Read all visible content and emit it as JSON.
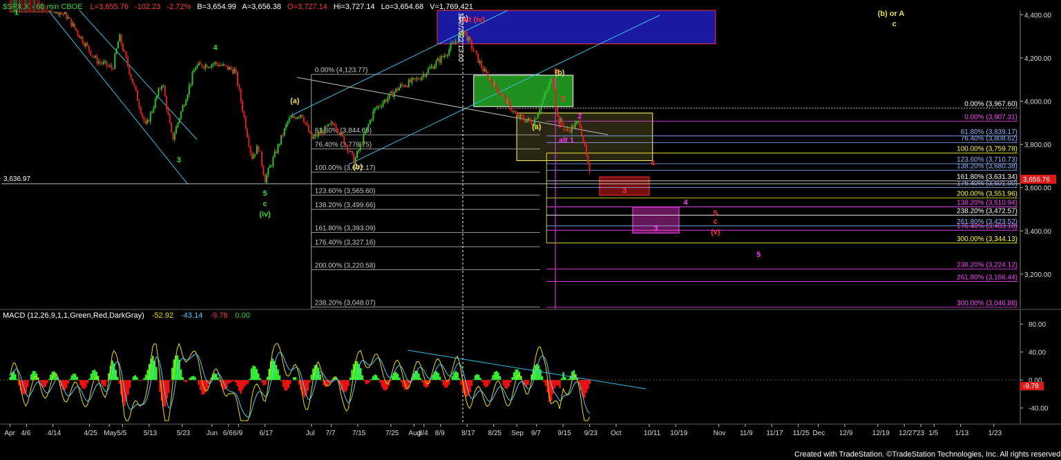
{
  "header": {
    "symbol": "$SPX.X - 60 min CBOE",
    "low": "L=3,655.76",
    "change": "-102.23",
    "change_pct": "-2.72%",
    "bid": "B=3,654.99",
    "ask": "A=3,656.38",
    "open": "O=3,727.14",
    "high": "Hi=3,727.14",
    "lo": "Lo=3,654.68",
    "volume": "V=1,769,421"
  },
  "colors": {
    "background": "#000000",
    "header_symbol": "#3bd43b",
    "header_red": "#ff3b3b",
    "header_white": "#ffffff",
    "up_candle": "#2fc02f",
    "down_candle": "#e02020",
    "macd_pos": "#33ee33",
    "macd_neg": "#ee1111",
    "macd_line": "#f0e000",
    "signal_line": "#4fd0ff",
    "trend": "#37bfe6",
    "wave_green": "#33dd33",
    "wave_yellow": "#e8e04a",
    "wave_red": "#ff3030",
    "wave_magenta": "#ff33ff",
    "fib_gray": "#c8c8c8",
    "fib_white": "#ffffff",
    "fib_yellow": "#ffff33",
    "fib_blue": "#8fb4ff",
    "fib_magenta": "#ff44ff"
  },
  "chart_data": [
    {
      "type": "candlestick",
      "title": "$SPX.X - 60 min CBOE",
      "ylim": [
        3040,
        4420
      ],
      "y_ticks": [
        "4,400.00",
        "4,200.00",
        "4,000.00",
        "3,800.00",
        "3,600.00",
        "3,400.00",
        "3,200.00"
      ],
      "y_tick_values": [
        4400,
        4200,
        4000,
        3800,
        3600,
        3400,
        3200
      ],
      "x_ticks": [
        "Apr",
        "4/6",
        "4/14",
        "4/25",
        "May",
        "5/5",
        "5/13",
        "5/23",
        "Jun",
        "6/6",
        "6/9",
        "6/17",
        "Jul",
        "7/7",
        "7/15",
        "7/25",
        "Aug",
        "8/4",
        "8/9",
        "8/17",
        "8/25",
        "Sep",
        "9/7",
        "9/15",
        "9/23",
        "Oct",
        "10/11",
        "10/19",
        "Nov",
        "11/9",
        "11/17",
        "11/25",
        "Dec",
        "12/9",
        "12/19",
        "12/27",
        "'23",
        "1/5",
        "1/13",
        "1/23"
      ],
      "x_tick_dates": [
        "2022-04-01",
        "2022-04-06",
        "2022-04-14",
        "2022-04-25",
        "2022-05-01",
        "2022-05-05",
        "2022-05-13",
        "2022-05-23",
        "2022-06-01",
        "2022-06-06",
        "2022-06-09",
        "2022-06-17",
        "2022-07-01",
        "2022-07-07",
        "2022-07-15",
        "2022-07-25",
        "2022-08-01",
        "2022-08-04",
        "2022-08-09",
        "2022-08-17",
        "2022-08-25",
        "2022-09-01",
        "2022-09-07",
        "2022-09-15",
        "2022-09-23",
        "2022-10-01",
        "2022-10-11",
        "2022-10-19",
        "2022-11-01",
        "2022-11-09",
        "2022-11-17",
        "2022-11-25",
        "2022-12-01",
        "2022-12-09",
        "2022-12-19",
        "2022-12-27",
        "2023-01-01",
        "2023-01-05",
        "2023-01-13",
        "2023-01-23"
      ],
      "price_path": [
        {
          "date": "2022-04-01",
          "price": 4540
        },
        {
          "date": "2022-04-04",
          "price": 4580
        },
        {
          "date": "2022-04-08",
          "price": 4485
        },
        {
          "date": "2022-04-18",
          "price": 4395
        },
        {
          "date": "2022-04-27",
          "price": 4190
        },
        {
          "date": "2022-05-02",
          "price": 4150
        },
        {
          "date": "2022-05-04",
          "price": 4300
        },
        {
          "date": "2022-05-12",
          "price": 3880
        },
        {
          "date": "2022-05-17",
          "price": 4090
        },
        {
          "date": "2022-05-20",
          "price": 3820
        },
        {
          "date": "2022-05-27",
          "price": 4160
        },
        {
          "date": "2022-06-02",
          "price": 4175
        },
        {
          "date": "2022-06-08",
          "price": 4140
        },
        {
          "date": "2022-06-13",
          "price": 3740
        },
        {
          "date": "2022-06-15",
          "price": 3790
        },
        {
          "date": "2022-06-17",
          "price": 3637
        },
        {
          "date": "2022-06-24",
          "price": 3910
        },
        {
          "date": "2022-06-28",
          "price": 3945
        },
        {
          "date": "2022-07-01",
          "price": 3825
        },
        {
          "date": "2022-07-08",
          "price": 3900
        },
        {
          "date": "2022-07-14",
          "price": 3723
        },
        {
          "date": "2022-07-20",
          "price": 3960
        },
        {
          "date": "2022-07-28",
          "price": 4070
        },
        {
          "date": "2022-08-02",
          "price": 4100
        },
        {
          "date": "2022-08-10",
          "price": 4210
        },
        {
          "date": "2022-08-16",
          "price": 4325
        },
        {
          "date": "2022-08-22",
          "price": 4140
        },
        {
          "date": "2022-08-26",
          "price": 4060
        },
        {
          "date": "2022-09-01",
          "price": 3930
        },
        {
          "date": "2022-09-06",
          "price": 3900
        },
        {
          "date": "2022-09-12",
          "price": 4120
        },
        {
          "date": "2022-09-13",
          "price": 3935
        },
        {
          "date": "2022-09-16",
          "price": 3860
        },
        {
          "date": "2022-09-20",
          "price": 3905
        },
        {
          "date": "2022-09-23",
          "price": 3660
        }
      ],
      "last_price_label": "3,656.76",
      "left_level_label": "3,636.97",
      "time_label": "11/2/2022 13:00",
      "zones": [
        {
          "name": "blue",
          "price_top": 4430,
          "price_bottom": 4265
        },
        {
          "name": "green",
          "price_top": 4120,
          "price_bottom": 3975
        },
        {
          "name": "yellow",
          "price_top": 3945,
          "price_bottom": 3725
        },
        {
          "name": "red",
          "label": "3",
          "price_top": 3650,
          "price_bottom": 3565
        },
        {
          "name": "magenta",
          "label": "3",
          "price_top": 3510,
          "price_bottom": 3390
        }
      ],
      "fib_levels": [
        {
          "label": "0.00% (4,123.77)",
          "price": 4123.77,
          "group": "gray"
        },
        {
          "label": "61.80% (3,844.65)",
          "price": 3844.65,
          "group": "gray"
        },
        {
          "label": "76.40% (3,778.75)",
          "price": 3778.75,
          "group": "gray"
        },
        {
          "label": "100.00% (3,672.17)",
          "price": 3672.17,
          "group": "gray"
        },
        {
          "label": "123.60% (3,565.60)",
          "price": 3565.6,
          "group": "gray"
        },
        {
          "label": "138.20% (3,499.66)",
          "price": 3499.66,
          "group": "gray"
        },
        {
          "label": "161.80% (3,393.09)",
          "price": 3393.09,
          "group": "gray"
        },
        {
          "label": "176.40% (3,327.16)",
          "price": 3327.16,
          "group": "gray"
        },
        {
          "label": "200.00% (3,220.58)",
          "price": 3220.58,
          "group": "gray"
        },
        {
          "label": "238.20% (3,048.07)",
          "price": 3048.07,
          "group": "gray"
        },
        {
          "label": "0.00% (3,967.60)",
          "price": 3967.6,
          "group": "white"
        },
        {
          "label": "0.00% (3,907.31)",
          "price": 3907.31,
          "group": "magenta"
        },
        {
          "label": "61.80% (3,839.17)",
          "price": 3839.17,
          "group": "blue"
        },
        {
          "label": "76.40% (3,808.62)",
          "price": 3808.62,
          "group": "blue"
        },
        {
          "label": "100.00% (3,759.78)",
          "price": 3759.78,
          "group": "yellow"
        },
        {
          "label": "123.60% (3,710.73)",
          "price": 3710.73,
          "group": "blue"
        },
        {
          "label": "138.20% (3,680.38)",
          "price": 3680.38,
          "group": "blue"
        },
        {
          "label": "161.80% (3,631.34)",
          "price": 3631.34,
          "group": "white"
        },
        {
          "label": "176.40% (3,601.00)",
          "price": 3601.0,
          "group": "blue"
        },
        {
          "label": "200.00% (3,551.96)",
          "price": 3551.96,
          "group": "yellow"
        },
        {
          "label": "138.20% (3,510.94)",
          "price": 3510.94,
          "group": "magenta"
        },
        {
          "label": "238.20% (3,472.57)",
          "price": 3472.57,
          "group": "white"
        },
        {
          "label": "261.80% (3,423.52)",
          "price": 3423.52,
          "group": "blue"
        },
        {
          "label": "176.40% (3,403.18)",
          "price": 3403.18,
          "group": "magenta"
        },
        {
          "label": "300.00% (3,344.13)",
          "price": 3344.13,
          "group": "yellow"
        },
        {
          "label": "238.20% (3,224.12)",
          "price": 3224.12,
          "group": "magenta"
        },
        {
          "label": "261.80% (3,166.44)",
          "price": 3166.44,
          "group": "magenta"
        },
        {
          "label": "300.00% (3,046.88)",
          "price": 3046.88,
          "group": "magenta"
        }
      ],
      "wave_labels": [
        {
          "text": "1",
          "date": "2022-04-03",
          "price": 4400,
          "color": "green"
        },
        {
          "text": "3",
          "date": "2022-05-22",
          "price": 3718,
          "color": "green"
        },
        {
          "text": "4",
          "date": "2022-06-02",
          "price": 4237,
          "color": "green"
        },
        {
          "text": "5",
          "date": "2022-06-17",
          "price": 3562,
          "color": "green"
        },
        {
          "text": "c",
          "date": "2022-06-17",
          "price": 3515,
          "color": "green"
        },
        {
          "text": "(iv)",
          "date": "2022-06-17",
          "price": 3466,
          "color": "green"
        },
        {
          "text": "(a)",
          "date": "2022-06-26",
          "price": 3990,
          "color": "yellow"
        },
        {
          "text": "(b)",
          "date": "2022-07-15",
          "price": 3685,
          "color": "yellow"
        },
        {
          "text": "(c)",
          "date": "2022-08-16",
          "price": 4372,
          "color": "white"
        },
        {
          "text": "alt (iv)",
          "date": "2022-08-19",
          "price": 4365,
          "color": "red"
        },
        {
          "text": "(a)",
          "date": "2022-09-07",
          "price": 3870,
          "color": "yellow"
        },
        {
          "text": "b",
          "date": "2022-09-13",
          "price": 4128,
          "color": "red"
        },
        {
          "text": "(b)",
          "date": "2022-09-14",
          "price": 4122,
          "color": "yellow"
        },
        {
          "text": "2",
          "date": "2022-09-15",
          "price": 4000,
          "color": "red"
        },
        {
          "text": "1",
          "date": "2022-09-14",
          "price": 3880,
          "color": "red"
        },
        {
          "text": "2",
          "date": "2022-09-20",
          "price": 3920,
          "color": "magenta"
        },
        {
          "text": "alt 1",
          "date": "2022-09-16",
          "price": 3808,
          "color": "magenta"
        },
        {
          "text": "4",
          "date": "2022-10-12",
          "price": 3703,
          "color": "red"
        },
        {
          "text": "4",
          "date": "2022-10-22",
          "price": 3520,
          "color": "magenta"
        },
        {
          "text": "5",
          "date": "2022-10-31",
          "price": 3472,
          "color": "red"
        },
        {
          "text": "c",
          "date": "2022-10-31",
          "price": 3433,
          "color": "red"
        },
        {
          "text": "(v)",
          "date": "2022-10-31",
          "price": 3384,
          "color": "red"
        },
        {
          "text": "5",
          "date": "2022-11-13",
          "price": 3280,
          "color": "magenta"
        },
        {
          "text": "(b) or A",
          "date": "2022-12-23",
          "price": 4395,
          "color": "yellow"
        },
        {
          "text": "c",
          "date": "2022-12-24",
          "price": 4346,
          "color": "yellow"
        }
      ]
    },
    {
      "type": "line",
      "title": "MACD (12,26,9,1,1,Green,Red,DarkGray)",
      "values_printed": [
        "-52.92",
        "-43.14",
        "-9.78",
        "0.00"
      ],
      "series": [
        {
          "name": "MACD",
          "value": -52.92
        },
        {
          "name": "Signal",
          "value": -43.14
        },
        {
          "name": "Histogram",
          "value": -9.78
        },
        {
          "name": "Zero",
          "value": 0.0
        }
      ],
      "ylim": [
        -62,
        100
      ],
      "y_ticks": [
        "80.00",
        "40.00",
        "0.00",
        "-40.00"
      ],
      "y_tick_values": [
        80,
        40,
        0,
        -40
      ],
      "last_value_label": "-9.78"
    }
  ],
  "footer": {
    "credit": "Created with TradeStation. ©TradeStation Technologies, Inc. All rights reserved."
  }
}
